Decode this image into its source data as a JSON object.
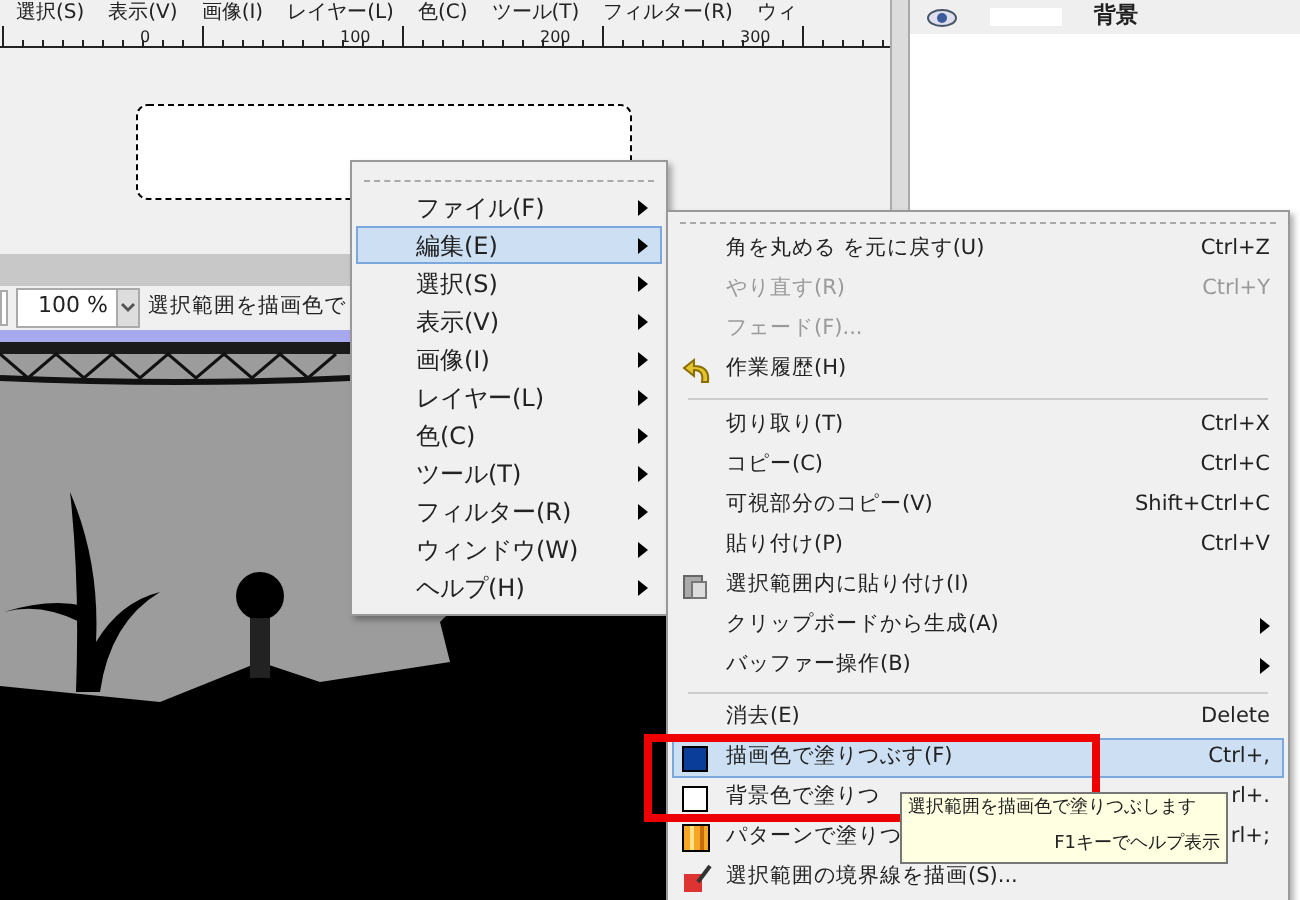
{
  "menubar": [
    "選択(S)",
    "表示(V)",
    "画像(I)",
    "レイヤー(L)",
    "色(C)",
    "ツール(T)",
    "フィルター(R)",
    "ウィ"
  ],
  "ruler": [
    "0",
    "100",
    "200",
    "300"
  ],
  "layers": [
    {
      "name": "背景",
      "visible": true
    }
  ],
  "status": {
    "zoom": "100 %",
    "message": "選択範囲を描画色で"
  },
  "context_menu": [
    {
      "label": "ファイル(F)",
      "selected": false
    },
    {
      "label": "編集(E)",
      "selected": true
    },
    {
      "label": "選択(S)",
      "selected": false
    },
    {
      "label": "表示(V)",
      "selected": false
    },
    {
      "label": "画像(I)",
      "selected": false
    },
    {
      "label": "レイヤー(L)",
      "selected": false
    },
    {
      "label": "色(C)",
      "selected": false
    },
    {
      "label": "ツール(T)",
      "selected": false
    },
    {
      "label": "フィルター(R)",
      "selected": false
    },
    {
      "label": "ウィンドウ(W)",
      "selected": false
    },
    {
      "label": "ヘルプ(H)",
      "selected": false
    }
  ],
  "submenu": [
    {
      "kind": "plain",
      "label": "角を丸める を元に戻す(U)",
      "shortcut": "Ctrl+Z",
      "disabled": false,
      "selected": false
    },
    {
      "kind": "plain",
      "label": "やり直す(R)",
      "shortcut": "Ctrl+Y",
      "disabled": true,
      "selected": false
    },
    {
      "kind": "plain",
      "label": "フェード(F)...",
      "disabled": true,
      "selected": false
    },
    {
      "kind": "history",
      "label": "作業履歴(H)",
      "disabled": false,
      "selected": false
    },
    {
      "kind": "separator"
    },
    {
      "kind": "plain",
      "label": "切り取り(T)",
      "shortcut": "Ctrl+X",
      "disabled": false,
      "selected": false
    },
    {
      "kind": "plain",
      "label": "コピー(C)",
      "shortcut": "Ctrl+C",
      "disabled": false,
      "selected": false
    },
    {
      "kind": "plain",
      "label": "可視部分のコピー(V)",
      "shortcut": "Shift+Ctrl+C",
      "disabled": false,
      "selected": false
    },
    {
      "kind": "plain",
      "label": "貼り付け(P)",
      "shortcut": "Ctrl+V",
      "disabled": false,
      "selected": false
    },
    {
      "kind": "paste",
      "label": "選択範囲内に貼り付け(I)",
      "disabled": false,
      "selected": false
    },
    {
      "kind": "plain",
      "label": "クリップボードから生成(A)",
      "submenu": true,
      "disabled": false,
      "selected": false
    },
    {
      "kind": "plain",
      "label": "バッファー操作(B)",
      "submenu": true,
      "disabled": false,
      "selected": false
    },
    {
      "kind": "separator"
    },
    {
      "kind": "plain",
      "label": "消去(E)",
      "shortcut": "Delete",
      "disabled": false,
      "selected": false
    },
    {
      "kind": "swatch",
      "label": "描画色で塗りつぶす(F)",
      "shortcut": "Ctrl+,",
      "color": "#0a3c9a",
      "disabled": false,
      "selected": true
    },
    {
      "kind": "swatch",
      "label": "背景色で塗りつ",
      "shortcut": "rl+.",
      "color": "#ffffff",
      "disabled": false,
      "selected": false
    },
    {
      "kind": "pattern",
      "label": "パターンで塗りつ",
      "shortcut": "rl+;",
      "disabled": false,
      "selected": false
    },
    {
      "kind": "stroke",
      "label": "選択範囲の境界線を描画(S)...",
      "disabled": false,
      "selected": false
    }
  ],
  "tooltip": {
    "text": "選択範囲を描画色で塗りつぶします",
    "hint": "F1キーでヘルプ表示"
  }
}
